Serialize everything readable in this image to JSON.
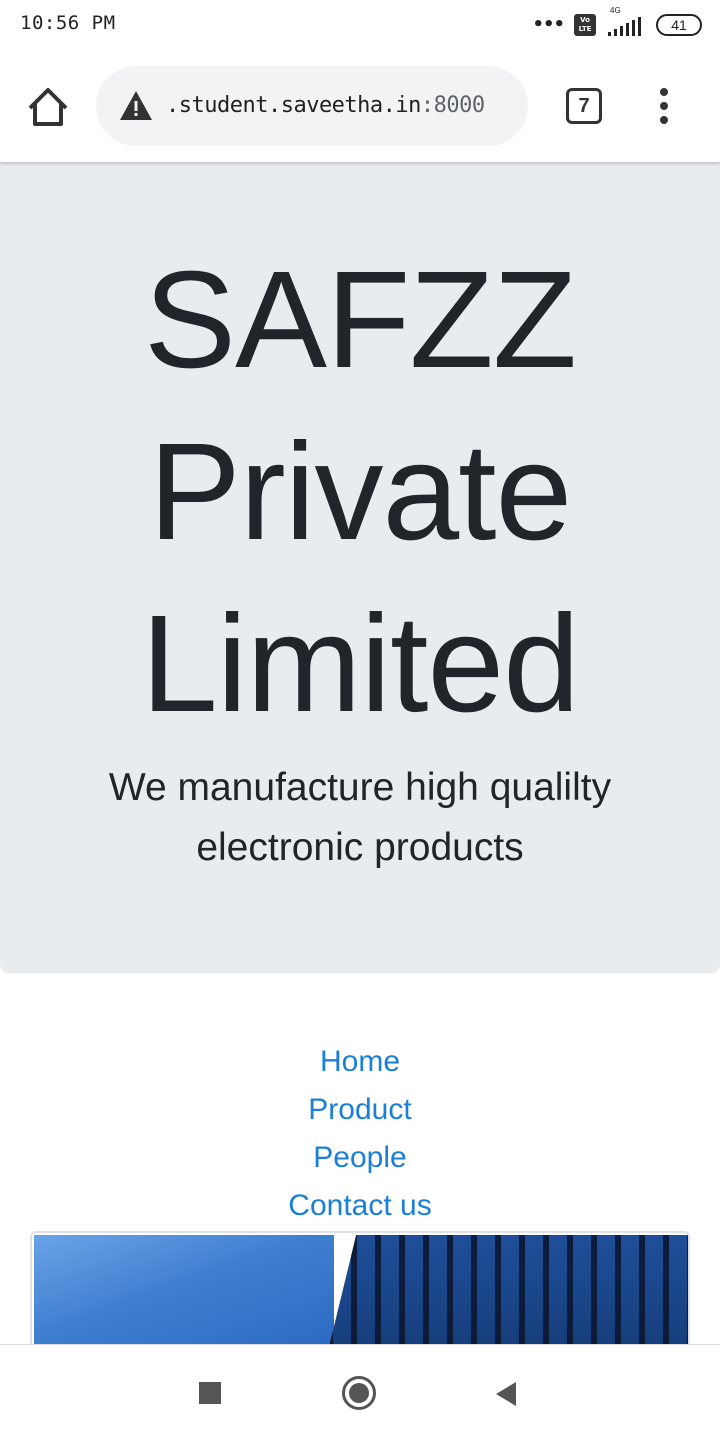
{
  "status_bar": {
    "time": "10:56 PM",
    "network_label": "4G",
    "volte_label": "Vo LTE",
    "battery_level": "41"
  },
  "browser": {
    "url_host": ".student.saveetha.in",
    "url_port": ":8000",
    "tab_count": "7",
    "icons": [
      "home-icon",
      "warning-icon",
      "tabs-icon",
      "overflow-menu-icon"
    ]
  },
  "hero": {
    "title": "SAFZZ Private Limited",
    "subtitle": "We manufacture high qualilty electronic products"
  },
  "nav": {
    "items": [
      {
        "label": "Home"
      },
      {
        "label": "Product"
      },
      {
        "label": "People"
      },
      {
        "label": "Contact us"
      }
    ]
  },
  "colors": {
    "hero_background": "#e9ecef",
    "link": "#1a7fd6",
    "text": "#212529"
  },
  "system_nav": {
    "icons": [
      "recents-icon",
      "home-circle-icon",
      "back-icon"
    ]
  }
}
